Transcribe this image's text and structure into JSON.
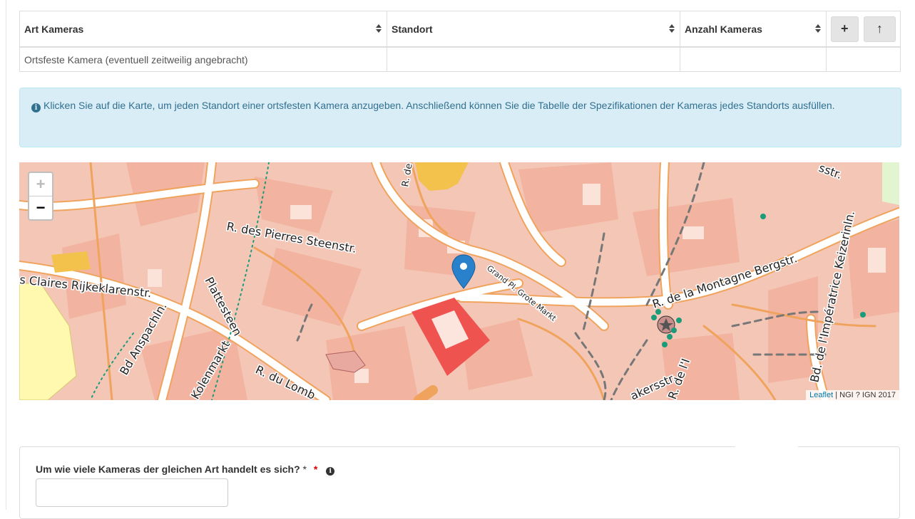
{
  "table": {
    "headers": [
      "Art Kameras",
      "Standort",
      "Anzahl Kameras"
    ],
    "row": [
      "Ortsfeste Kamera (eventuell zeitweilig angebracht)",
      "",
      ""
    ],
    "add_label": "+",
    "up_label": "↑"
  },
  "alert": {
    "text": "Klicken Sie auf die Karte, um jeden Standort einer ortsfesten Kamera anzugeben. Anschließend können Sie die Tabelle der Spezifikationen der Kameras jedes Standorts ausfüllen."
  },
  "map": {
    "zoom_in": "+",
    "zoom_out": "−",
    "attribution_link": "Leaflet",
    "attribution_text": " | NGI ? IGN 2017",
    "labels": {
      "pierres": "R. des Pierres Steenstr.",
      "rijkeklaren": "s Claires Rijkeklarenstr.",
      "plattesteen": "Plattesteen",
      "anspach": "Bd Anspachln.",
      "kolenmarkt": "Kolenmarkt",
      "lombard": "R. du Lomb",
      "grandplace": "Grand Pl. Grote Markt",
      "montagne": "R. de la Montagne Bergstr.",
      "imperatrice": "Bd. de l'Impératrice Keizerinln.",
      "bakers": "akersstr.",
      "dele": "R. de l'I",
      "de": "R. de",
      "sstr": "sstr."
    },
    "colors": {
      "building": "#f2b8a4",
      "block": "#f4c6b6",
      "road": "#ffffff",
      "road_edge": "#f0a35c",
      "highlight": "#ef5350",
      "marker": "#2a81cb",
      "dots": "#1a9c7a"
    }
  },
  "form": {
    "question": "Um wie viele Kameras der gleichen Art handelt es sich?",
    "required_marker": "*",
    "required_star": "*",
    "input_value": ""
  }
}
